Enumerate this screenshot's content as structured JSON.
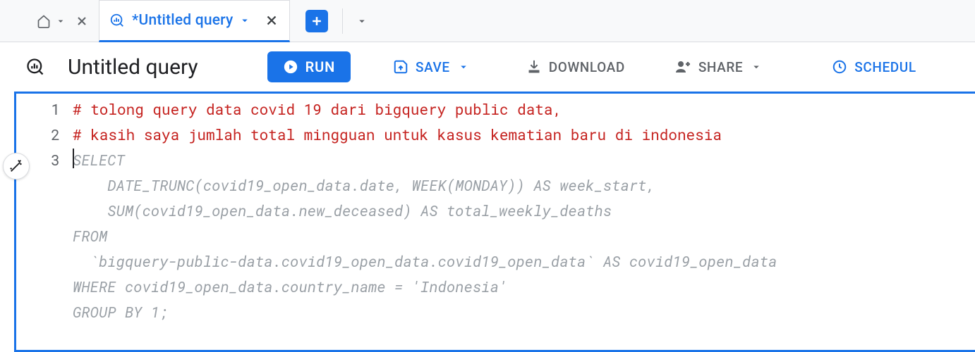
{
  "tabs": {
    "active_title": "*Untitled query"
  },
  "toolbar": {
    "title": "Untitled query",
    "run": "RUN",
    "save": "SAVE",
    "download": "DOWNLOAD",
    "share": "SHARE",
    "schedule": "SCHEDUL"
  },
  "editor": {
    "line_numbers": [
      "1",
      "2",
      "3"
    ],
    "comment1": "# tolong query data covid 19 dari bigquery public data,",
    "comment2": "# kasih saya jumlah total mingguan untuk kasus kematian baru di indonesia",
    "suggest1": "SELECT",
    "suggest2": "    DATE_TRUNC(covid19_open_data.date, WEEK(MONDAY)) AS week_start,",
    "suggest3": "    SUM(covid19_open_data.new_deceased) AS total_weekly_deaths",
    "suggest4": "FROM",
    "suggest5": "  `bigquery-public-data.covid19_open_data.covid19_open_data` AS covid19_open_data",
    "suggest6": "WHERE covid19_open_data.country_name = 'Indonesia'",
    "suggest7": "GROUP BY 1;"
  }
}
